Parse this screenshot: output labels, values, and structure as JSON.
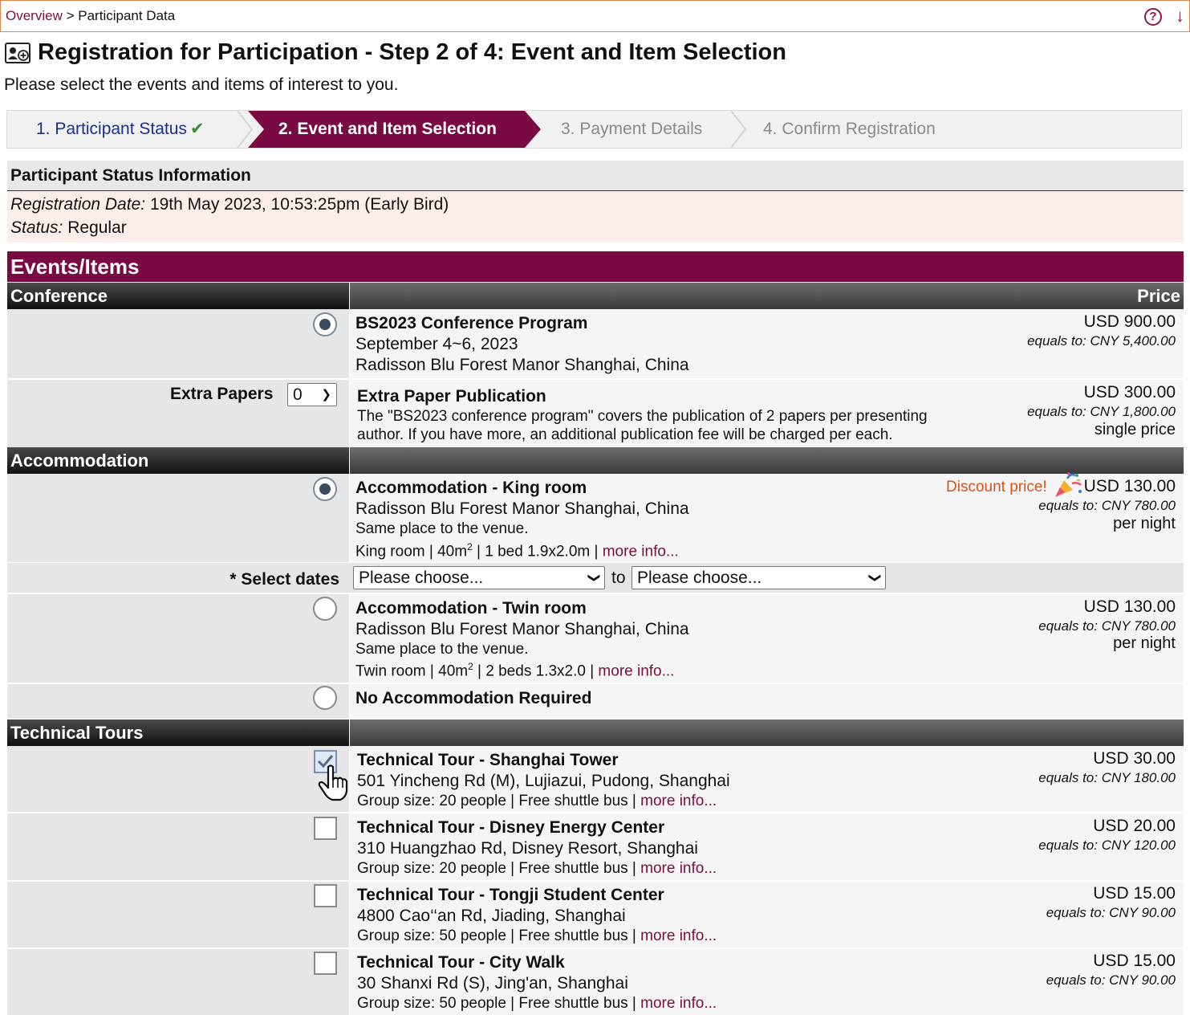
{
  "breadcrumb": {
    "overview": "Overview",
    "sep": ">",
    "current": "Participant Data"
  },
  "header": {
    "title": "Registration for Participation - Step 2 of 4: Event and Item Selection",
    "subtitle": "Please select the events and items of interest to you."
  },
  "wizard": {
    "step1": "1. Participant Status",
    "step2": "2. Event and Item Selection",
    "step3": "3. Payment Details",
    "step4": "4. Confirm Registration",
    "step2_color": "#7a0b42"
  },
  "participant_status": {
    "heading": "Participant Status Information",
    "reg_date_label": "Registration Date:",
    "reg_date_value": "19th May 2023, 10:53:25pm (Early Bird)",
    "status_label": "Status:",
    "status_value": "Regular"
  },
  "events": {
    "heading": "Events/Items",
    "categories": {
      "conference": "Conference",
      "price_header": "Price",
      "accommodation": "Accommodation",
      "tours": "Technical Tours"
    },
    "conference_program": {
      "title": "BS2023 Conference Program",
      "date": "September 4~6, 2023",
      "venue": "Radisson Blu Forest Manor Shanghai, China",
      "price": "USD 900.00",
      "equals": "equals to: CNY 5,400.00",
      "selected": true
    },
    "extra_paper": {
      "label": "Extra Papers",
      "quantity": "0",
      "title": "Extra Paper Publication",
      "desc1": "The \"BS2023 conference program\" covers the publication of 2 papers per presenting",
      "desc2": "author. If you have more, an additional publication fee will be charged per each.",
      "price": "USD 300.00",
      "equals": "equals to: CNY 1,800.00",
      "unit": "single price"
    },
    "king_room": {
      "title": "Accommodation - King room",
      "venue": "Radisson Blu Forest Manor Shanghai, China",
      "note": "Same place to the venue.",
      "specs_a": "King room | 40m",
      "specs_sup": "2",
      "specs_b": " | 1 bed 1.9x2.0m | ",
      "more": "more info...",
      "discount": "Discount price!",
      "price": "USD 130.00",
      "equals": "equals to: CNY 780.00",
      "unit": "per night",
      "selected": true
    },
    "dates": {
      "label": "* Select dates",
      "from": "Please choose...",
      "to_word": "to",
      "to": "Please choose..."
    },
    "twin_room": {
      "title": "Accommodation - Twin room",
      "venue": "Radisson Blu Forest Manor Shanghai, China",
      "note": "Same place to the venue.",
      "specs_a": "Twin room | 40m",
      "specs_sup": "2",
      "specs_b": " | 2 beds 1.3x2.0 | ",
      "more": "more info...",
      "price": "USD 130.00",
      "equals": "equals to: CNY 780.00",
      "unit": "per night"
    },
    "no_accommodation": {
      "title": "No Accommodation Required"
    },
    "tours": [
      {
        "title": "Technical Tour - Shanghai Tower",
        "address": "501 Yincheng Rd (M), Lujiazui, Pudong, Shanghai",
        "group": "Group size: 20 people | Free shuttle bus | ",
        "more": "more info...",
        "price": "USD 30.00",
        "equals": "equals to: CNY 180.00",
        "checked": true
      },
      {
        "title": "Technical Tour - Disney Energy Center",
        "address": "310 Huangzhao Rd, Disney Resort, Shanghai",
        "group": "Group size: 20 people | Free shuttle bus | ",
        "more": "more info...",
        "price": "USD 20.00",
        "equals": "equals to: CNY 120.00",
        "checked": false
      },
      {
        "title": "Technical Tour - Tongji Student Center",
        "address": "4800 Cao‘‘an Rd, Jiading, Shanghai",
        "group": "Group size: 50 people | Free shuttle bus | ",
        "more": "more info...",
        "price": "USD 15.00",
        "equals": "equals to: CNY 90.00",
        "checked": false
      },
      {
        "title": "Technical Tour - City Walk",
        "address": "30 Shanxi Rd (S), Jing'an, Shanghai",
        "group": "Group size: 50 people | Free shuttle bus | ",
        "more": "more info...",
        "price": "USD 15.00",
        "equals": "equals to: CNY 90.00",
        "checked": false
      }
    ]
  }
}
